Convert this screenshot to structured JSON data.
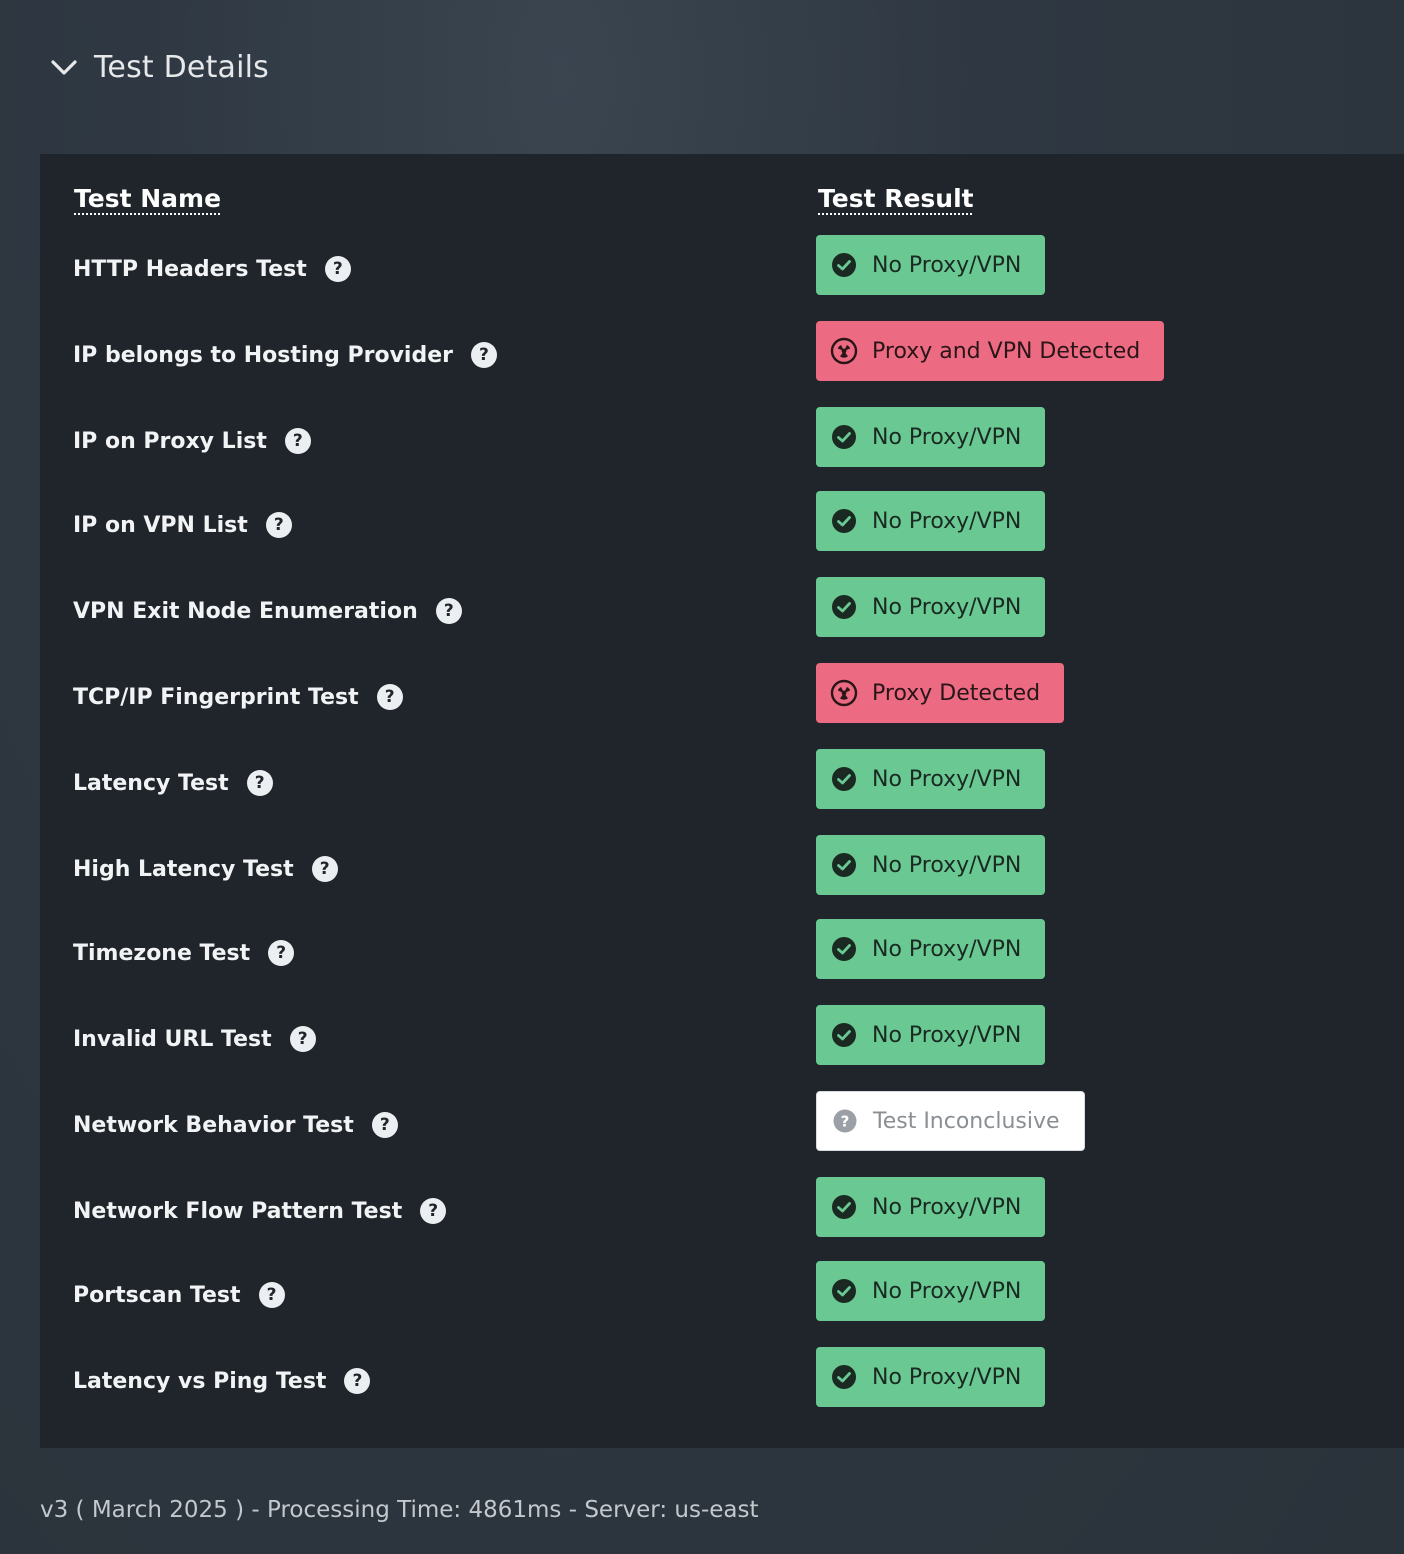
{
  "section": {
    "title": "Test Details",
    "expanded": true
  },
  "table": {
    "headers": {
      "name": "Test Name",
      "result": "Test Result"
    },
    "rows": [
      {
        "name": "HTTP Headers Test",
        "result": "No Proxy/VPN",
        "status": "pass"
      },
      {
        "name": "IP belongs to Hosting Provider",
        "result": "Proxy and VPN Detected",
        "status": "fail"
      },
      {
        "name": "IP on Proxy List",
        "result": "No Proxy/VPN",
        "status": "pass"
      },
      {
        "name": "IP on VPN List",
        "result": "No Proxy/VPN",
        "status": "pass"
      },
      {
        "name": "VPN Exit Node Enumeration",
        "result": "No Proxy/VPN",
        "status": "pass"
      },
      {
        "name": "TCP/IP Fingerprint Test",
        "result": "Proxy Detected",
        "status": "fail"
      },
      {
        "name": "Latency Test",
        "result": "No Proxy/VPN",
        "status": "pass"
      },
      {
        "name": "High Latency Test",
        "result": "No Proxy/VPN",
        "status": "pass"
      },
      {
        "name": "Timezone Test",
        "result": "No Proxy/VPN",
        "status": "pass"
      },
      {
        "name": "Invalid URL Test",
        "result": "No Proxy/VPN",
        "status": "pass"
      },
      {
        "name": "Network Behavior Test",
        "result": "Test Inconclusive",
        "status": "unknown"
      },
      {
        "name": "Network Flow Pattern Test",
        "result": "No Proxy/VPN",
        "status": "pass"
      },
      {
        "name": "Portscan Test",
        "result": "No Proxy/VPN",
        "status": "pass"
      },
      {
        "name": "Latency vs Ping Test",
        "result": "No Proxy/VPN",
        "status": "pass"
      }
    ]
  },
  "footer": {
    "text": "v3 ( March 2025 ) - Processing Time: 4861ms - Server: us-east"
  },
  "icons": {
    "help": "question-circle-icon",
    "pass": "check-circle-icon",
    "fail": "radiation-icon",
    "unknown": "question-circle-icon",
    "toggle": "chevron-down-icon"
  },
  "colors": {
    "pass": "#6ac993",
    "fail": "#ec6b82",
    "unknown": "#ffffff"
  }
}
